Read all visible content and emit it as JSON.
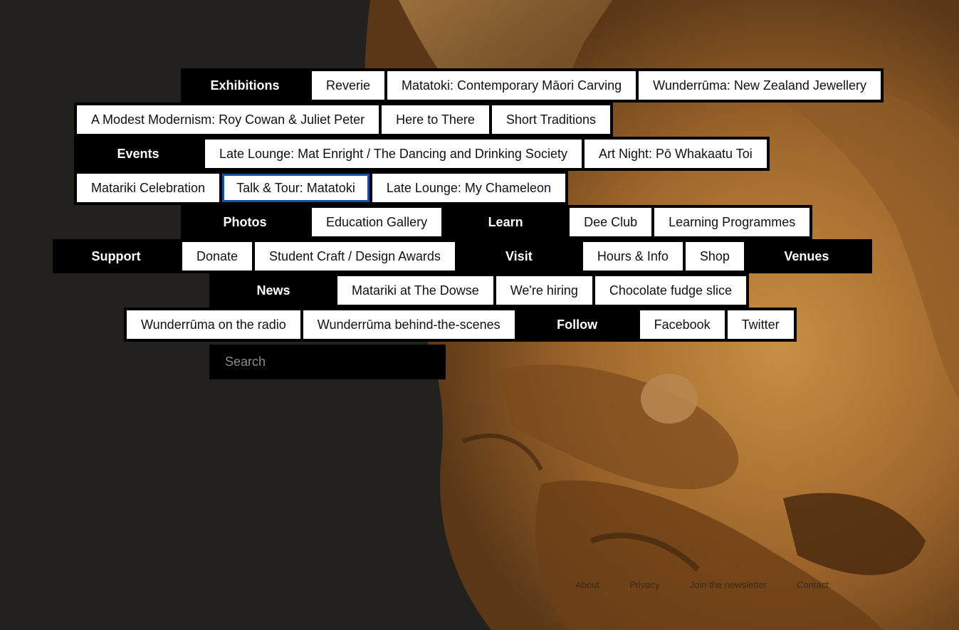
{
  "colors": {
    "background": "#22211d",
    "header_bg": "#000000",
    "link_bg": "#ffffff",
    "focus_outline": "#1a4fa0"
  },
  "search": {
    "placeholder": "Search"
  },
  "footer": {
    "about": "About",
    "privacy": "Privacy",
    "join": "Join the newsletter",
    "contact": "Contact"
  },
  "menu": {
    "exhibitions": "Exhibitions",
    "reverie": "Reverie",
    "matatoki_carving": "Matatoki: Contemporary Māori Carving",
    "wunderruma_jewellery": "Wunderrūma: New Zealand Jewellery",
    "modest_modernism": "A Modest Modernism: Roy Cowan & Juliet Peter",
    "here_to_there": "Here to There",
    "short_traditions": "Short Traditions",
    "events": "Events",
    "late_lounge_mat": "Late Lounge: Mat Enright / The Dancing and Drinking Society",
    "art_night": "Art Night: Pō Whakaatu Toi",
    "matariki_celebration": "Matariki Celebration",
    "talk_tour": "Talk & Tour: Matatoki",
    "late_lounge_chameleon": "Late Lounge: My Chameleon",
    "photos": "Photos",
    "education_gallery": "Education Gallery",
    "learn": "Learn",
    "dee_club": "Dee Club",
    "learning_programmes": "Learning Programmes",
    "support": "Support",
    "donate": "Donate",
    "student_craft": "Student Craft / Design Awards",
    "visit": "Visit",
    "hours_info": "Hours & Info",
    "shop": "Shop",
    "venues": "Venues",
    "news": "News",
    "matariki_dowse": "Matariki at The Dowse",
    "hiring": "We're hiring",
    "fudge": "Chocolate fudge slice",
    "radio": "Wunderrūma on the radio",
    "behind_scenes": "Wunderrūma behind-the-scenes",
    "follow": "Follow",
    "facebook": "Facebook",
    "twitter": "Twitter"
  }
}
